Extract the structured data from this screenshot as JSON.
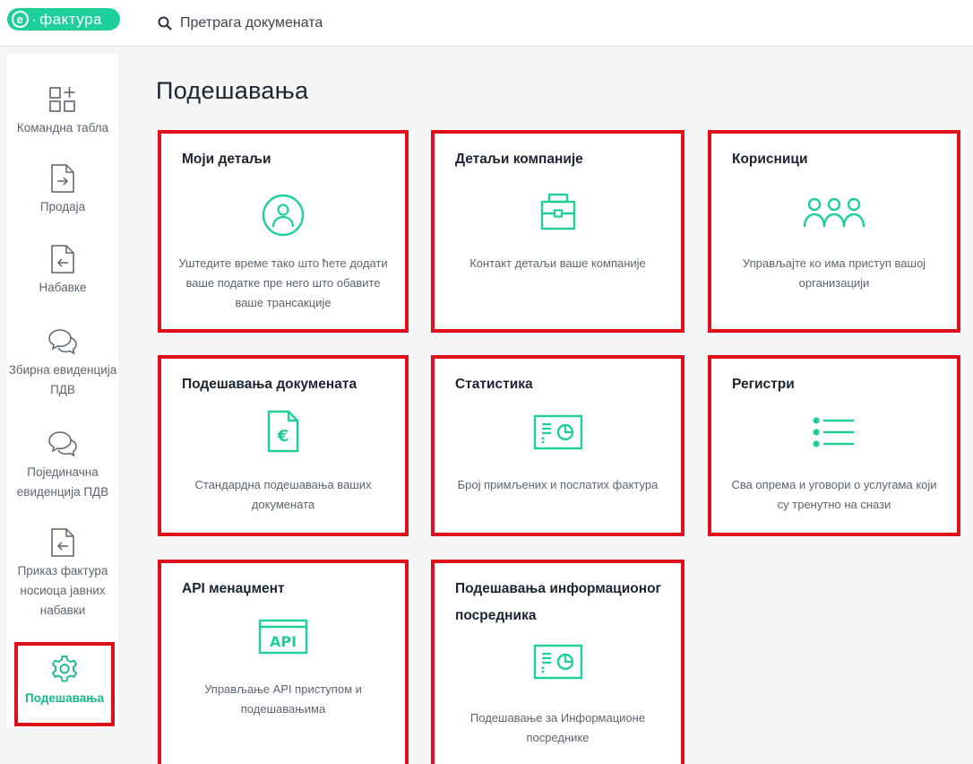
{
  "app": {
    "logo_text": "фактура",
    "logo_mark": "e"
  },
  "search": {
    "placeholder": "Претрага докумената"
  },
  "sidebar": {
    "items": [
      {
        "label": "Командна табла"
      },
      {
        "label": "Продаја"
      },
      {
        "label": "Набавке"
      },
      {
        "label": "Збирна евиденција ПДВ"
      },
      {
        "label": "Појединачна евиденција ПДВ"
      },
      {
        "label": "Приказ фактура носиоца јавних набавки"
      },
      {
        "label": "Подешавања"
      }
    ]
  },
  "page": {
    "title": "Подешавања"
  },
  "cards": [
    {
      "title": "Моји детаљи",
      "desc": "Уштедите време тако што ћете додати ваше податке пре него што обавите ваше трансакције"
    },
    {
      "title": "Детаљи компаније",
      "desc": "Контакт детаљи ваше компаније"
    },
    {
      "title": "Корисници",
      "desc": "Управљајте ко има приступ вашој организацији"
    },
    {
      "title": "Подешавања докумената",
      "desc": "Стандардна подешавања ваших докумената"
    },
    {
      "title": "Статистика",
      "desc": "Број примљених и послатих фактура"
    },
    {
      "title": "Регистри",
      "desc": "Сва опрема и уговори о услугама који су тренутно на снази"
    },
    {
      "title": "API менаџмент",
      "icon_text": "API",
      "desc": "Управљање API приступом и подешавањима"
    },
    {
      "title": "Подешавања информационог посредника",
      "desc": "Подешавање за Информационе посреднике"
    }
  ],
  "colors": {
    "accent": "#1fcf9b",
    "highlight": "#e0101a",
    "text": "#1a2533",
    "muted": "#5c6470"
  }
}
